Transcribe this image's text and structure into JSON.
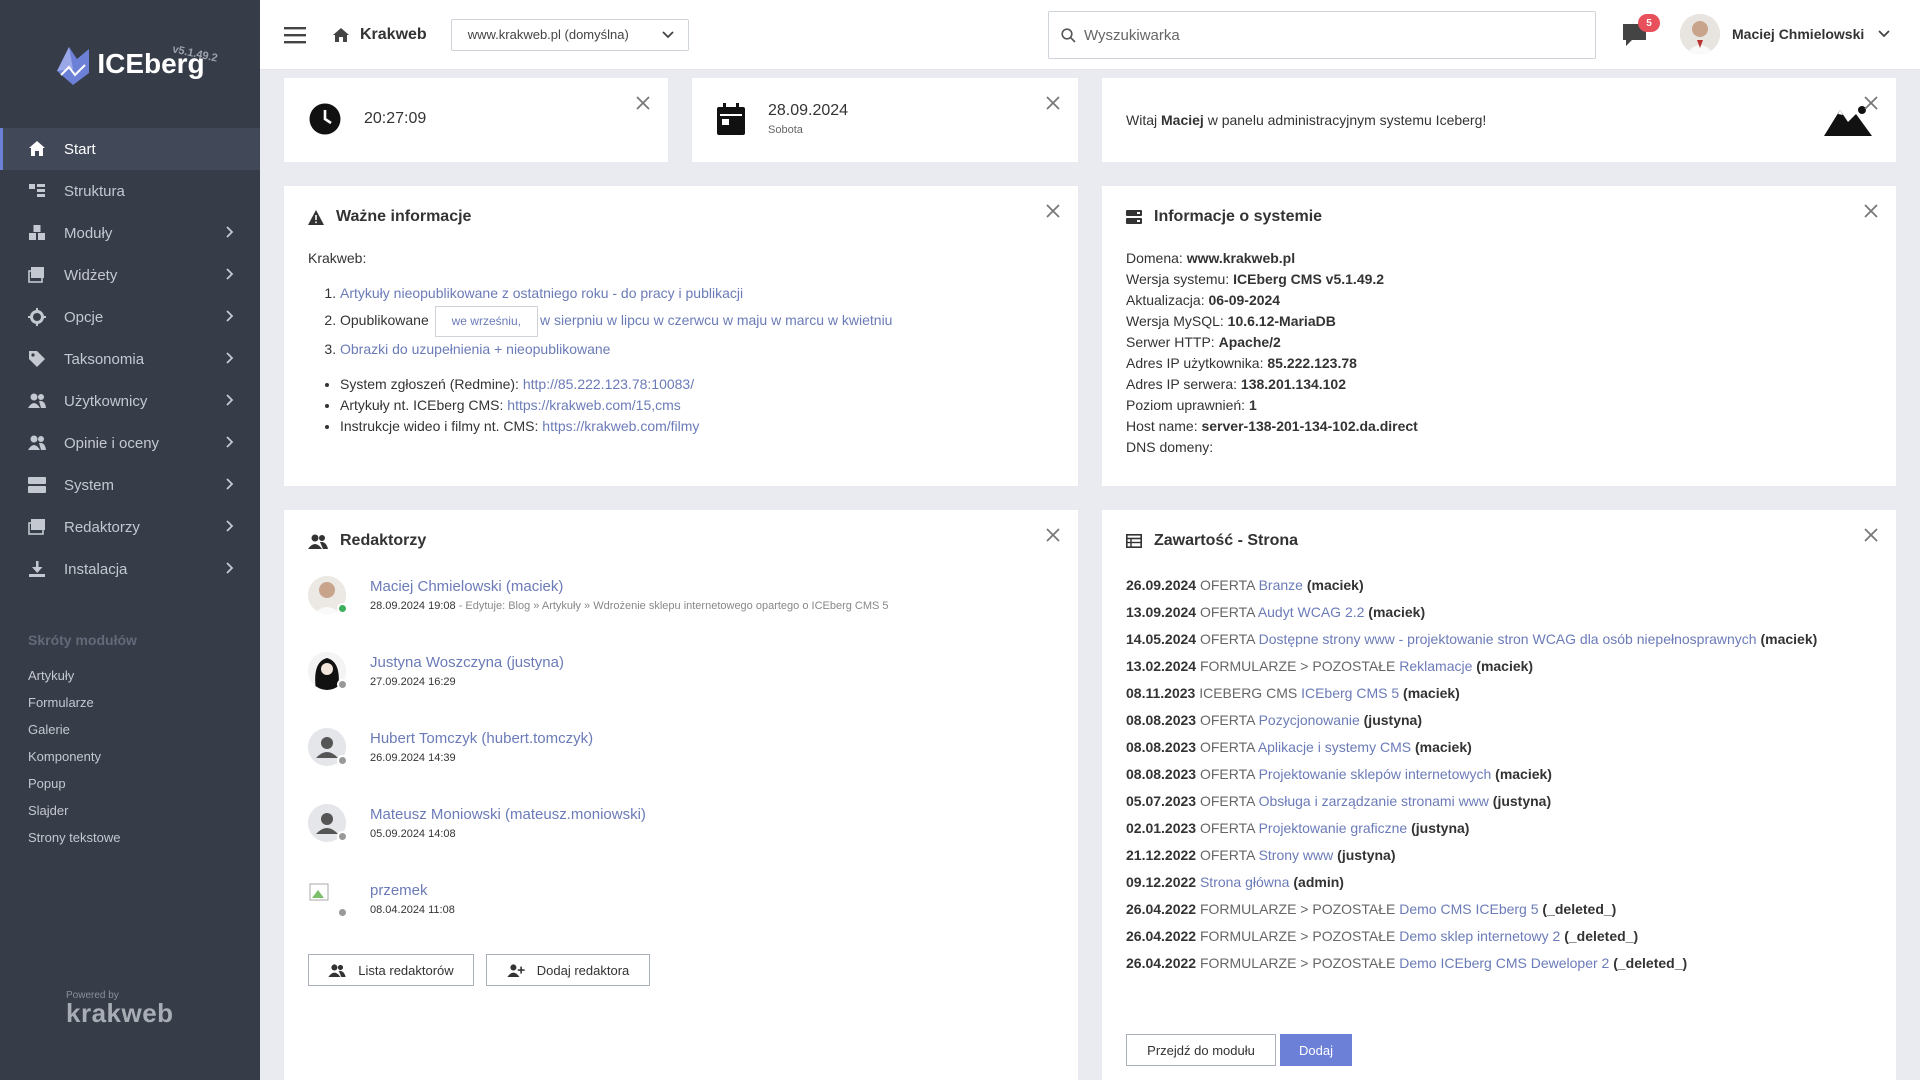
{
  "brand": {
    "name": "ICEberg",
    "version": "v5.1.49.2",
    "powered_by": "Powered by",
    "powered_name": "krakweb",
    "accent": "#6d80d8",
    "sidebar_bg": "#363c48"
  },
  "sidebar": {
    "items": [
      {
        "label": "Start",
        "icon": "home-icon",
        "active": true,
        "chevron": false
      },
      {
        "label": "Struktura",
        "icon": "structure-icon",
        "chevron": false
      },
      {
        "label": "Moduły",
        "icon": "cubes-icon",
        "chevron": true
      },
      {
        "label": "Widżety",
        "icon": "widgets-icon",
        "chevron": true
      },
      {
        "label": "Opcje",
        "icon": "gear-icon",
        "chevron": true
      },
      {
        "label": "Taksonomia",
        "icon": "tag-icon",
        "chevron": true
      },
      {
        "label": "Użytkownicy",
        "icon": "users-icon",
        "chevron": true
      },
      {
        "label": "Opinie i oceny",
        "icon": "users-icon",
        "chevron": true
      },
      {
        "label": "System",
        "icon": "server-icon",
        "chevron": true
      },
      {
        "label": "Redaktorzy",
        "icon": "image-icon",
        "chevron": true
      },
      {
        "label": "Instalacja",
        "icon": "download-icon",
        "chevron": true
      }
    ],
    "shortcuts_title": "Skróty modułów",
    "shortcuts": [
      "Artykuły",
      "Formularze",
      "Galerie",
      "Komponenty",
      "Popup",
      "Slajder",
      "Strony tekstowe"
    ]
  },
  "topbar": {
    "site_title": "Krakweb",
    "site_select": "www.krakweb.pl (domyślna)",
    "search_placeholder": "Wyszukiwarka",
    "messages_count": "5",
    "user_name": "Maciej Chmielowski"
  },
  "clock": {
    "time": "20:27:09"
  },
  "date": {
    "date": "28.09.2024",
    "day": "Sobota"
  },
  "welcome": {
    "prefix": "Witaj ",
    "name": "Maciej",
    "suffix": " w panelu administracyjnym systemu Iceberg!"
  },
  "important": {
    "title": "Ważne informacje",
    "intro": "Krakweb:",
    "item1": "Artykuły nieopublikowane z ostatniego roku - do pracy i publikacji",
    "item2_label": "Opublikowane",
    "item2_tag": "we wrześniu,",
    "item2_links": [
      "w sierpniu",
      "w lipcu",
      "w czerwcu",
      "w maju",
      "w marcu",
      "w kwietniu"
    ],
    "item3": "Obrazki do uzupełnienia + nieopublikowane",
    "bullets": [
      {
        "label": "System zgłoszeń (Redmine): ",
        "link": "http://85.222.123.78:10083/"
      },
      {
        "label": "Artykuły nt. ICEberg CMS: ",
        "link": "https://krakweb.com/15,cms"
      },
      {
        "label": "Instrukcje wideo i filmy nt. CMS: ",
        "link": "https://krakweb.com/filmy"
      }
    ]
  },
  "system": {
    "title": "Informacje o systemie",
    "rows": [
      {
        "label": "Domena: ",
        "value": "www.krakweb.pl"
      },
      {
        "label": "Wersja systemu: ",
        "value": "ICEberg CMS v5.1.49.2"
      },
      {
        "label": "Aktualizacja: ",
        "value": "06-09-2024"
      },
      {
        "label": "Wersja MySQL: ",
        "value": "10.6.12-MariaDB"
      },
      {
        "label": "Serwer HTTP: ",
        "value": "Apache/2"
      },
      {
        "label": "Adres IP użytkownika: ",
        "value": "85.222.123.78"
      },
      {
        "label": "Adres IP serwera: ",
        "value": "138.201.134.102"
      },
      {
        "label": "Poziom uprawnień: ",
        "value": "1"
      },
      {
        "label": "Host name: ",
        "value": "server-138-201-134-102.da.direct"
      },
      {
        "label": "DNS domeny: ",
        "value": ""
      }
    ]
  },
  "editors": {
    "title": "Redaktorzy",
    "list": [
      {
        "name": "Maciej Chmielowski (maciek)",
        "time": "28.09.2024 19:08",
        "extra": " - Edytuje: Blog » Artykuły » Wdrożenie sklepu internetowego opartego o ICEberg CMS 5",
        "status": "#3cb05a"
      },
      {
        "name": "Justyna Woszczyna (justyna)",
        "time": "27.09.2024 16:29",
        "extra": "",
        "status": "#999999"
      },
      {
        "name": "Hubert Tomczyk (hubert.tomczyk)",
        "time": "26.09.2024 14:39",
        "extra": "",
        "status": "#999999"
      },
      {
        "name": "Mateusz Moniowski (mateusz.moniowski)",
        "time": "05.09.2024 14:08",
        "extra": "",
        "status": "#999999"
      },
      {
        "name": "przemek",
        "time": "08.04.2024 11:08",
        "extra": "",
        "status": "#999999"
      }
    ],
    "btn_list": "Lista redaktorów",
    "btn_add": "Dodaj redaktora"
  },
  "content": {
    "title": "Zawartość - Strona",
    "rows": [
      {
        "date": "26.09.2024",
        "cat": "OFERTA",
        "link": "Branze",
        "author": "(maciek)"
      },
      {
        "date": "13.09.2024",
        "cat": "OFERTA",
        "link": "Audyt WCAG 2.2",
        "author": "(maciek)"
      },
      {
        "date": "14.05.2024",
        "cat": "OFERTA",
        "link": "Dostępne strony www - projektowanie stron WCAG dla osób niepełnosprawnych",
        "author": "(maciek)"
      },
      {
        "date": "13.02.2024",
        "cat": "FORMULARZE > POZOSTAŁE",
        "link": "Reklamacje",
        "author": "(maciek)"
      },
      {
        "date": "08.11.2023",
        "cat": "ICEBERG CMS",
        "link": "ICEberg CMS 5",
        "author": "(maciek)"
      },
      {
        "date": "08.08.2023",
        "cat": "OFERTA",
        "link": "Pozycjonowanie",
        "author": "(justyna)"
      },
      {
        "date": "08.08.2023",
        "cat": "OFERTA",
        "link": "Aplikacje i systemy CMS",
        "author": "(maciek)"
      },
      {
        "date": "08.08.2023",
        "cat": "OFERTA",
        "link": "Projektowanie sklepów internetowych",
        "author": "(maciek)"
      },
      {
        "date": "05.07.2023",
        "cat": "OFERTA",
        "link": "Obsługa i zarządzanie stronami www",
        "author": "(justyna)"
      },
      {
        "date": "02.01.2023",
        "cat": "OFERTA",
        "link": "Projektowanie graficzne",
        "author": "(justyna)"
      },
      {
        "date": "21.12.2022",
        "cat": "OFERTA",
        "link": "Strony www",
        "author": "(justyna)"
      },
      {
        "date": "09.12.2022",
        "cat": "",
        "link": "Strona główna",
        "author": "(admin)"
      },
      {
        "date": "26.04.2022",
        "cat": "FORMULARZE > POZOSTAŁE",
        "link": "Demo CMS ICEberg 5",
        "author": "(_deleted_)"
      },
      {
        "date": "26.04.2022",
        "cat": "FORMULARZE > POZOSTAŁE",
        "link": "Demo sklep internetowy 2",
        "author": "(_deleted_)"
      },
      {
        "date": "26.04.2022",
        "cat": "FORMULARZE > POZOSTAŁE",
        "link": "Demo ICEberg CMS Deweloper 2",
        "author": "(_deleted_)"
      }
    ],
    "btn_go": "Przejdź do modułu",
    "btn_add": "Dodaj"
  }
}
